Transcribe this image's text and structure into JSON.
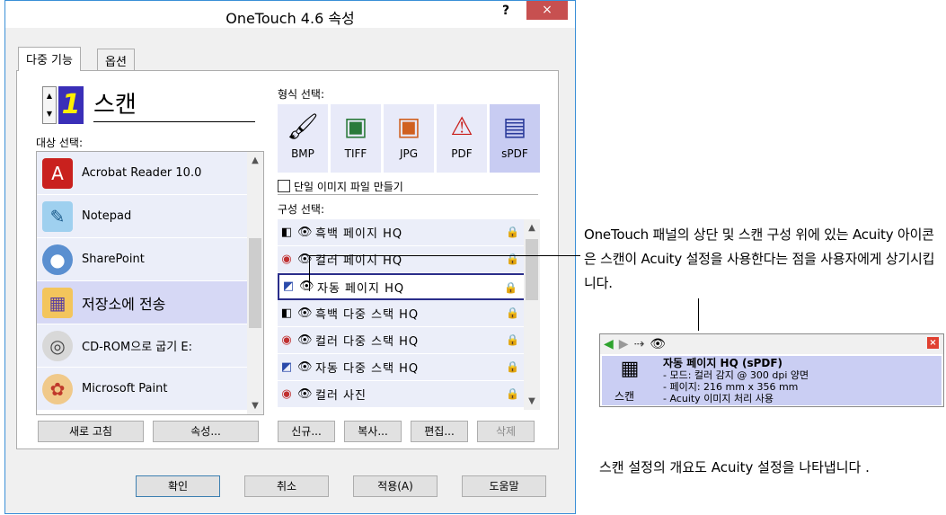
{
  "window": {
    "title": "OneTouch 4.6 속성",
    "help": "?",
    "close": "×"
  },
  "tabs": [
    {
      "label": "다중 기능"
    },
    {
      "label": "옵션"
    }
  ],
  "scan": {
    "number": "1",
    "name": "스캔"
  },
  "labels": {
    "destination": "대상 선택:",
    "format": "형식 선택:",
    "config": "구성 선택:",
    "single_image": "단일 이미지 파일 만들기"
  },
  "destinations": [
    {
      "label": "Acrobat Reader 10.0",
      "icon": "acrobat-icon",
      "color": "#c9211e"
    },
    {
      "label": "Notepad",
      "icon": "notepad-icon",
      "color": "#4a9bd6"
    },
    {
      "label": "SharePoint",
      "icon": "sharepoint-icon",
      "color": "#3b7bbf"
    },
    {
      "label": "저장소에 전송",
      "icon": "folder-icon",
      "color": "#e8b74a"
    },
    {
      "label": "CD-ROM으로 굽기 E:",
      "icon": "cd-icon",
      "color": "#888888"
    },
    {
      "label": "Microsoft Paint",
      "icon": "paint-icon",
      "color": "#d57f2a"
    }
  ],
  "formats": [
    {
      "label": "BMP",
      "icon": "bmp-icon"
    },
    {
      "label": "TIFF",
      "icon": "tiff-icon"
    },
    {
      "label": "JPG",
      "icon": "jpg-icon"
    },
    {
      "label": "PDF",
      "icon": "pdf-icon"
    },
    {
      "label": "sPDF",
      "icon": "spdf-icon"
    }
  ],
  "configs": [
    {
      "label": "흑백 페이지 HQ",
      "icon": "bw-icon"
    },
    {
      "label": "컬러 페이지 HQ",
      "icon": "color-icon"
    },
    {
      "label": "자동 페이지 HQ",
      "icon": "auto-icon"
    },
    {
      "label": "흑백 다중 스택 HQ",
      "icon": "bw-icon"
    },
    {
      "label": "컬러 다중 스택 HQ",
      "icon": "color-icon"
    },
    {
      "label": "자동 다중 스택 HQ",
      "icon": "auto-icon"
    },
    {
      "label": "컬러 사진",
      "icon": "color-icon"
    }
  ],
  "buttons": {
    "refresh": "새로 고침",
    "properties": "속성...",
    "new": "신규...",
    "copy": "복사...",
    "edit": "편집...",
    "delete": "삭제",
    "ok": "확인",
    "cancel": "취소",
    "apply": "적용(A)",
    "help": "도움말"
  },
  "callout_top": "OneTouch 패널의 상단 및 스캔 구성 위에 있는 Acuity 아이콘은 스캔이 Acuity 설정을 사용한다는 점을 사용자에게 상기시킵니다.",
  "mini_panel": {
    "icon_label": "스캔",
    "heading": "자동 페이지 HQ (sPDF)",
    "line1": "- 모드: 컬러 감지 @ 300 dpi 양면",
    "line2": "- 페이지: 216 mm x 356 mm",
    "line3": "- Acuity 이미지 처리 사용"
  },
  "callout_bottom": "스캔 설정의 개요도 Acuity 설정을 나타냅니다 ."
}
